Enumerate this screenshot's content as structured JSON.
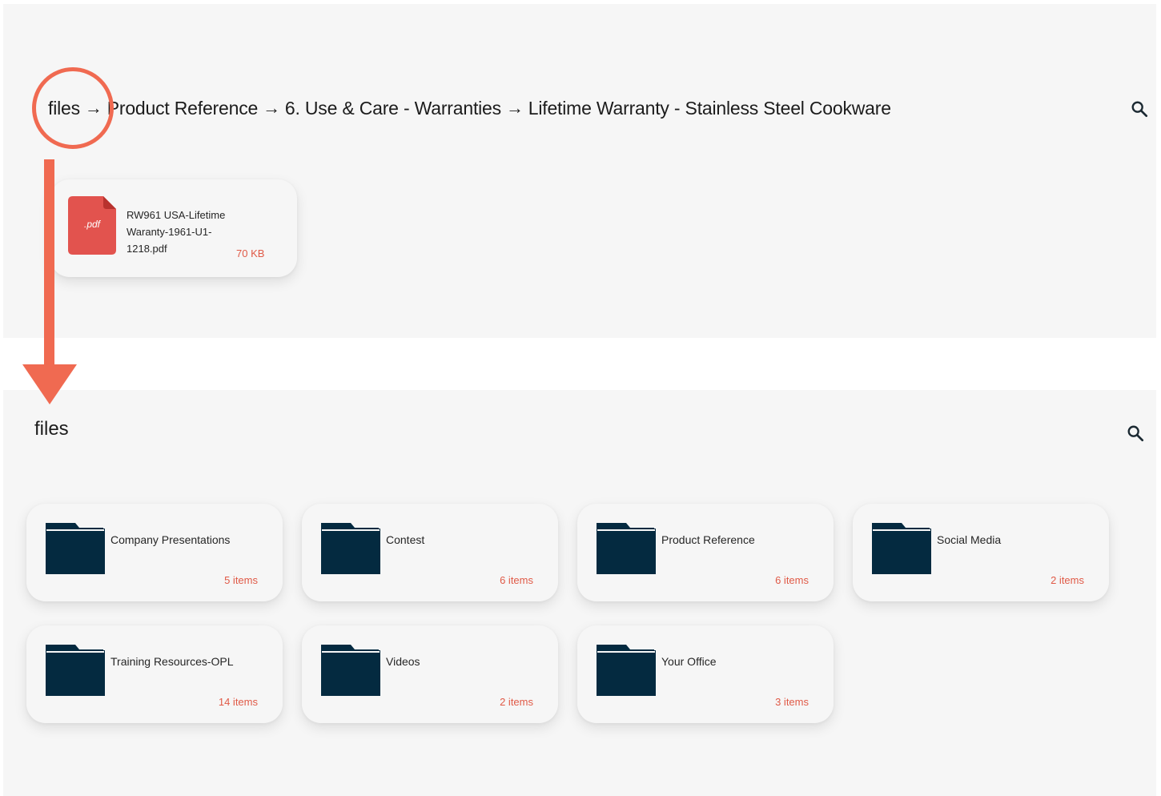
{
  "top_view": {
    "breadcrumb": [
      "files",
      "Product Reference",
      "6. Use & Care - Warranties",
      "Lifetime Warranty - Stainless Steel Cookware"
    ],
    "separator": "→",
    "file": {
      "icon": "pdf-file-icon",
      "extension": ".pdf",
      "name": "RW961 USA-Lifetime Waranty-1961-U1-1218.pdf",
      "size": "70 KB"
    },
    "search_icon": "search-icon"
  },
  "bottom_view": {
    "title": "files",
    "search_icon": "search-icon",
    "folders": [
      {
        "name": "Company Presentations",
        "count": "5 items"
      },
      {
        "name": "Contest",
        "count": "6 items"
      },
      {
        "name": "Product Reference",
        "count": "6 items"
      },
      {
        "name": "Social Media",
        "count": "2 items"
      },
      {
        "name": "Training Resources-OPL",
        "count": "14 items"
      },
      {
        "name": "Videos",
        "count": "2 items"
      },
      {
        "name": "Your Office",
        "count": "3 items"
      }
    ]
  },
  "colors": {
    "accent": "#f06a51",
    "count_text": "#e05a47",
    "folder": "#042a40",
    "pdf": "#e2534e",
    "panel_bg": "#f6f6f6"
  }
}
